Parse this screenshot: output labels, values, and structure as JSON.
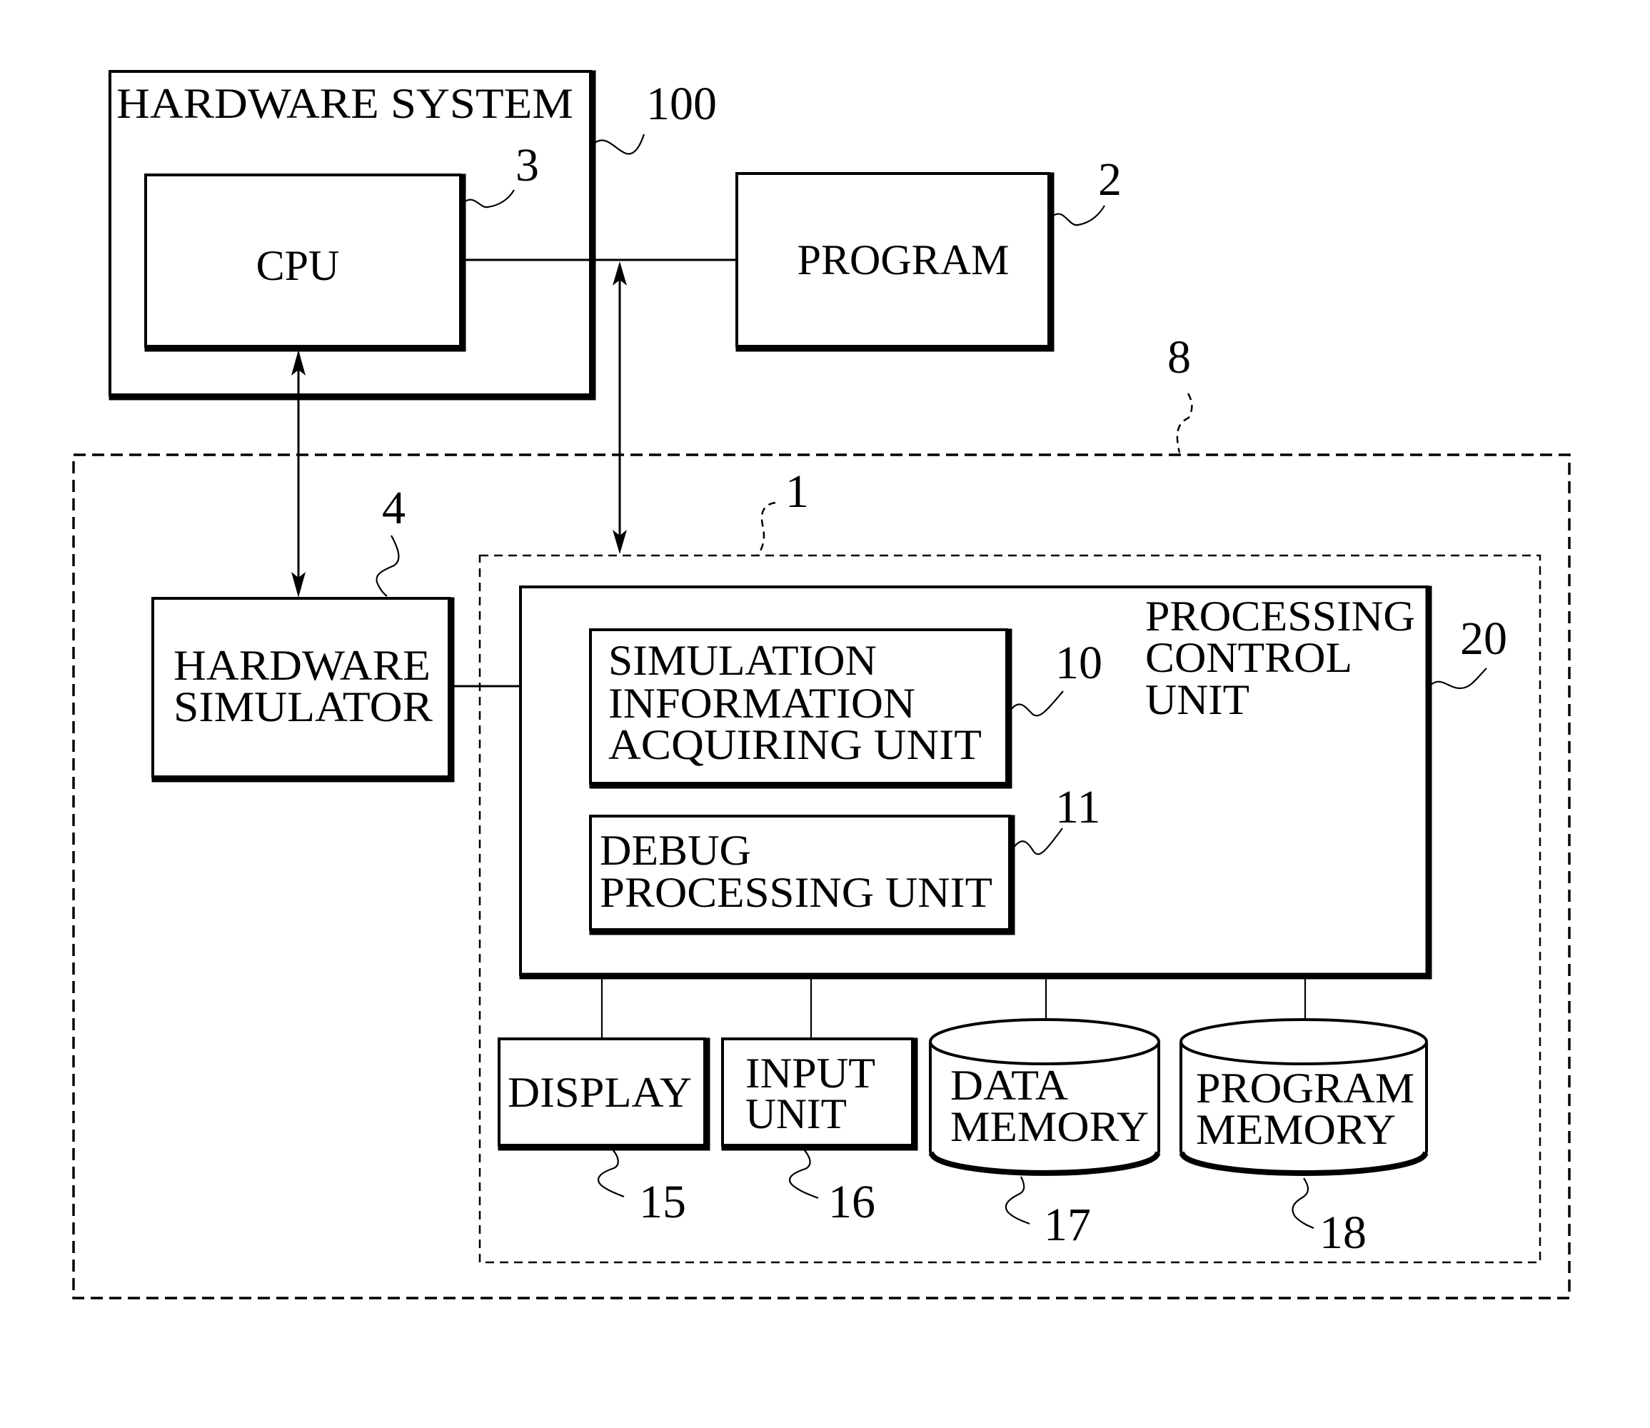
{
  "figure": {
    "hardware_system": {
      "title": "HARDWARE SYSTEM",
      "ref": "100"
    },
    "cpu": {
      "label": "CPU",
      "ref": "3"
    },
    "program": {
      "label": "PROGRAM",
      "ref": "2"
    },
    "outer_system": {
      "ref": "8"
    },
    "debug_device": {
      "ref": "1"
    },
    "hardware_simulator": {
      "lines": [
        "HARDWARE",
        "SIMULATOR"
      ],
      "ref": "4"
    },
    "processing_control_unit": {
      "lines": [
        "PROCESSING",
        "CONTROL",
        "UNIT"
      ],
      "ref": "20"
    },
    "simulation_info_unit": {
      "lines": [
        "SIMULATION",
        "INFORMATION",
        "ACQUIRING  UNIT"
      ],
      "ref": "10"
    },
    "debug_processing_unit": {
      "lines": [
        "DEBUG",
        "PROCESSING  UNIT"
      ],
      "ref": "11"
    },
    "display": {
      "label": "DISPLAY",
      "ref": "15"
    },
    "input_unit": {
      "lines": [
        "INPUT",
        "UNIT"
      ],
      "ref": "16"
    },
    "data_memory": {
      "lines": [
        "DATA",
        "MEMORY"
      ],
      "ref": "17"
    },
    "program_memory": {
      "lines": [
        "PROGRAM",
        "MEMORY"
      ],
      "ref": "18"
    }
  },
  "colors": {
    "ink": "#000000",
    "paper": "#ffffff"
  }
}
